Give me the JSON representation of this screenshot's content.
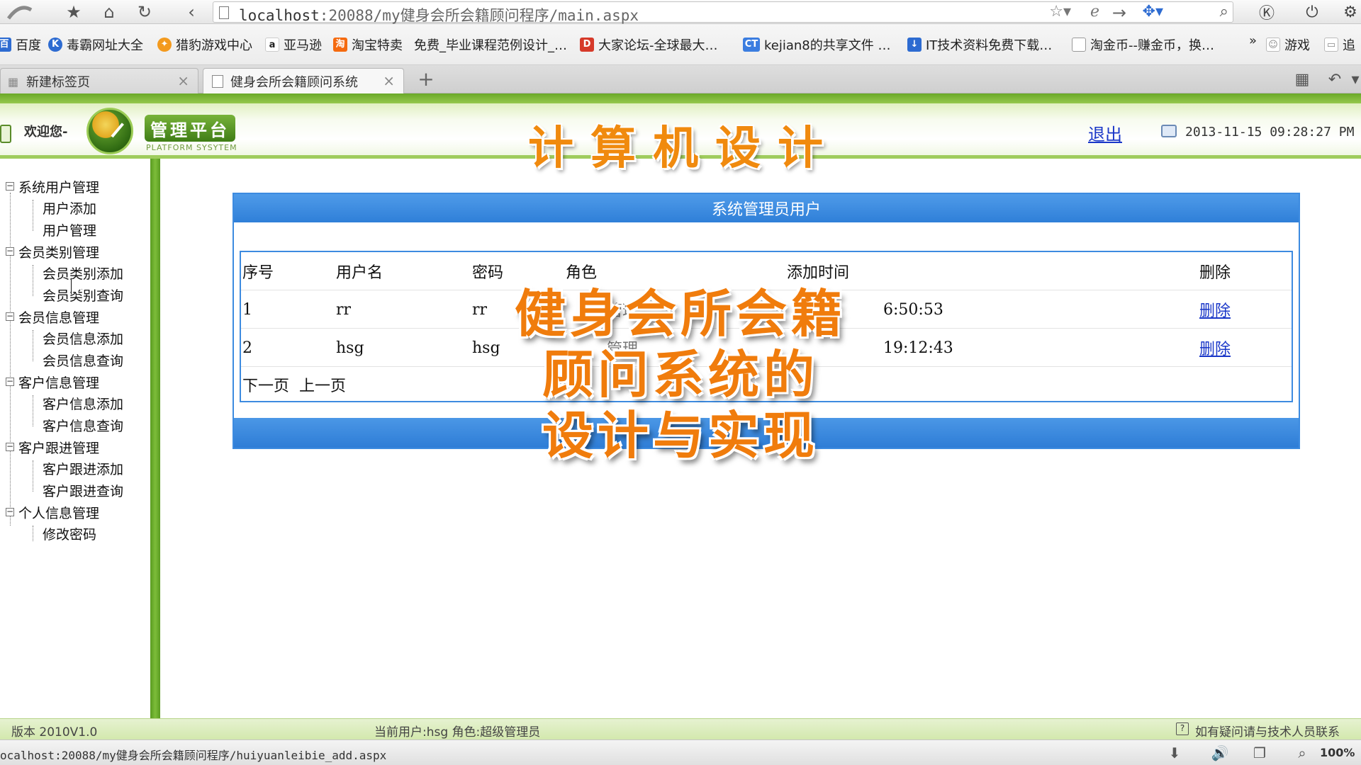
{
  "browser": {
    "url_host": "localhost",
    "url_rest": ":20088/my健身会所会籍顾问程序/main.aspx",
    "bookmarks": [
      {
        "label": "百度",
        "icon": "baidu-icon",
        "color": "#2d6bd1"
      },
      {
        "label": "毒霸网址大全",
        "icon": "duba-icon",
        "color": "#2d6bd1"
      },
      {
        "label": "猎豹游戏中心",
        "icon": "liebao-icon",
        "color": "#f39a1e"
      },
      {
        "label": "亚马逊",
        "icon": "amazon-icon",
        "color": "#222222"
      },
      {
        "label": "淘宝特卖",
        "icon": "taobao-icon",
        "color": "#f56a0f"
      },
      {
        "label": "免费_毕业课程范例设计_…",
        "icon": "none",
        "color": ""
      },
      {
        "label": "大家论坛-全球最大…",
        "icon": "forum-icon",
        "color": "#d63a2a"
      },
      {
        "label": "kejian8的共享文件 …",
        "icon": "ct-icon",
        "color": "#3b7de0"
      },
      {
        "label": "IT技术资料免费下载…",
        "icon": "download-icon",
        "color": "#2d6bd1"
      },
      {
        "label": "淘金币--赚金币，换…",
        "icon": "page-icon",
        "color": "#999999"
      },
      {
        "label": "»",
        "icon": "none",
        "color": ""
      },
      {
        "label": "游戏",
        "icon": "game-icon",
        "color": "#888888"
      },
      {
        "label": "追",
        "icon": "tv-icon",
        "color": "#888888"
      }
    ],
    "tabs": [
      {
        "label": "新建标签页",
        "active": false
      },
      {
        "label": "健身会所会籍顾问系统",
        "active": true
      }
    ],
    "status_url": "ocalhost:20088/my健身会所会籍顾问程序/huiyuanleibie_add.aspx",
    "zoom": "100%"
  },
  "header": {
    "welcome": "欢迎您-",
    "brand": "管理平台",
    "brand_sub": "PLATFORM SYSYTEM",
    "logout": "退出",
    "datetime": "2013-11-15 09:28:27 PM"
  },
  "overlay": {
    "title": "计算机设计",
    "line1": "健身会所会籍",
    "line2": "顾问系统的",
    "line3": "设计与实现"
  },
  "sidebar": {
    "groups": [
      {
        "label": "系统用户管理",
        "items": [
          "用户添加",
          "用户管理"
        ]
      },
      {
        "label": "会员类别管理",
        "items": [
          "会员类别添加",
          "会员类别查询"
        ]
      },
      {
        "label": "会员信息管理",
        "items": [
          "会员信息添加",
          "会员信息查询"
        ]
      },
      {
        "label": "客户信息管理",
        "items": [
          "客户信息添加",
          "客户信息查询"
        ]
      },
      {
        "label": "客户跟进管理",
        "items": [
          "客户跟进添加",
          "客户跟进查询"
        ]
      },
      {
        "label": "个人信息管理",
        "items": [
          "修改密码"
        ]
      }
    ]
  },
  "panel": {
    "title": "系统管理员用户",
    "columns": [
      "序号",
      "用户名",
      "密码",
      "角色",
      "添加时间",
      "删除"
    ],
    "rows": [
      {
        "no": "1",
        "username": "rr",
        "password": "rr",
        "role": "管理",
        "time": "6:50:53",
        "delete": "删除"
      },
      {
        "no": "2",
        "username": "hsg",
        "password": "hsg",
        "role": "管理",
        "time": "19:12:43",
        "delete": "删除"
      }
    ],
    "next_page": "下一页",
    "prev_page": "上一页"
  },
  "footer": {
    "version": "版本 2010V1.0",
    "current_user": "当前用户:hsg 角色:超级管理员",
    "help": "如有疑问请与技术人员联系"
  }
}
